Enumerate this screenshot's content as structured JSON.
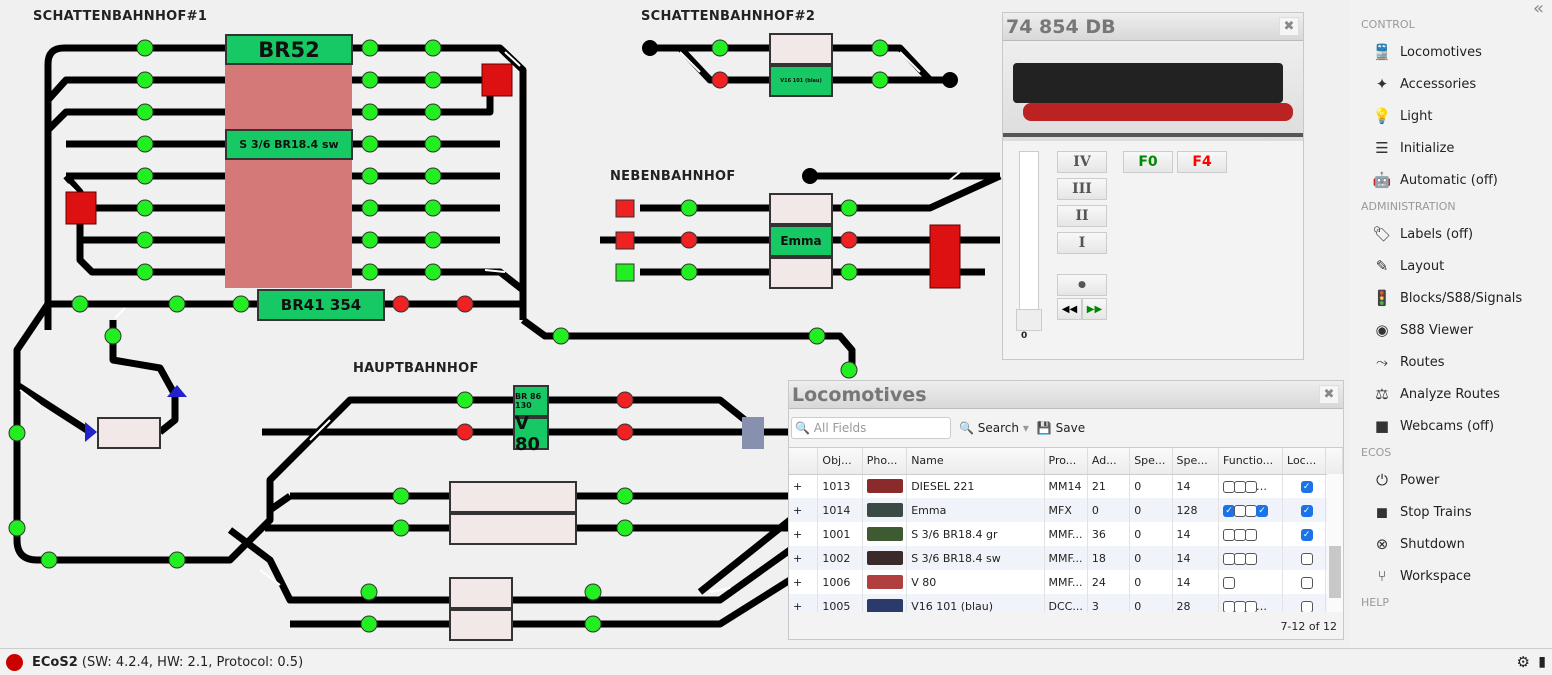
{
  "layout": {
    "titles": [
      "SCHATTENBAHNHOF#1",
      "SCHATTENBAHNHOF#2",
      "NEBENBAHNHOF",
      "HAUPTBAHNHOF"
    ],
    "blocks": {
      "br52": "BR52",
      "s36sw": "S 3/6 BR18.4 sw",
      "br41": "BR41 354",
      "v16": "V16 101 (blau)",
      "emma": "Emma",
      "br86": "BR 86 130",
      "v80": "V 80"
    }
  },
  "loco_panel": {
    "title": "74 854 DB",
    "speed_steps": [
      "IV",
      "III",
      "II",
      "I"
    ],
    "functions": [
      "F0",
      "F4"
    ],
    "speed_value": "0",
    "speed_fraction": 0,
    "close": "✖"
  },
  "locomotives": {
    "title": "Locomotives",
    "search_placeholder": "All Fields",
    "search_label": "Search",
    "save_label": "Save",
    "columns": [
      "",
      "Obj...",
      "Pho...",
      "Name",
      "Pro...",
      "Ad...",
      "Spe...",
      "Spe...",
      "Functio...",
      "Loc..."
    ],
    "rows": [
      {
        "obj": "1013",
        "photo": "#8b2a2a",
        "name": "DIESEL 221",
        "proto": "MM14",
        "addr": "21",
        "speed": "0",
        "steps": "14",
        "functions": [
          0,
          0,
          0
        ],
        "more": true,
        "loc": true
      },
      {
        "obj": "1014",
        "photo": "#3a4a44",
        "name": "Emma",
        "proto": "MFX",
        "addr": "0",
        "speed": "0",
        "steps": "128",
        "functions": [
          1,
          0,
          0,
          1
        ],
        "more": false,
        "loc": true
      },
      {
        "obj": "1001",
        "photo": "#3e5a32",
        "name": "S 3/6 BR18.4 gr",
        "proto": "MMF...",
        "addr": "36",
        "speed": "0",
        "steps": "14",
        "functions": [
          0,
          0,
          0
        ],
        "more": false,
        "loc": true
      },
      {
        "obj": "1002",
        "photo": "#3a2a2a",
        "name": "S 3/6 BR18.4 sw",
        "proto": "MMF...",
        "addr": "18",
        "speed": "0",
        "steps": "14",
        "functions": [
          0,
          0,
          0
        ],
        "more": false,
        "loc": false
      },
      {
        "obj": "1006",
        "photo": "#b04040",
        "name": "V 80",
        "proto": "MMF...",
        "addr": "24",
        "speed": "0",
        "steps": "14",
        "functions": [
          0
        ],
        "more": false,
        "loc": false
      },
      {
        "obj": "1005",
        "photo": "#2a3a6a",
        "name": "V16 101 (blau)",
        "proto": "DCC...",
        "addr": "3",
        "speed": "0",
        "steps": "28",
        "functions": [
          0,
          0,
          0
        ],
        "more": true,
        "loc": false
      }
    ],
    "pager": "7-12 of 12"
  },
  "sidebar": {
    "collapse": "«",
    "sections": [
      {
        "label": "CONTROL",
        "items": [
          {
            "icon": "locomotive-icon",
            "g": "🚆",
            "label": "Locomotives"
          },
          {
            "icon": "magic-wand-icon",
            "g": "✦",
            "label": "Accessories"
          },
          {
            "icon": "lightbulb-icon",
            "g": "💡",
            "label": "Light"
          },
          {
            "icon": "checklist-icon",
            "g": "☰",
            "label": "Initialize"
          },
          {
            "icon": "robot-icon",
            "g": "🤖",
            "label": "Automatic (off)"
          }
        ]
      },
      {
        "label": "ADMINISTRATION",
        "items": [
          {
            "icon": "tag-icon",
            "g": "🏷",
            "label": "Labels (off)"
          },
          {
            "icon": "edit-icon",
            "g": "✎",
            "label": "Layout"
          },
          {
            "icon": "traffic-light-icon",
            "g": "🚦",
            "label": "Blocks/S88/Signals"
          },
          {
            "icon": "viewer-icon",
            "g": "◉",
            "label": "S88 Viewer"
          },
          {
            "icon": "route-icon",
            "g": "⤳",
            "label": "Routes"
          },
          {
            "icon": "analyze-icon",
            "g": "⚖",
            "label": "Analyze Routes"
          },
          {
            "icon": "webcam-icon",
            "g": "■",
            "label": "Webcams (off)"
          }
        ]
      },
      {
        "label": "ECOS",
        "items": [
          {
            "icon": "power-icon",
            "g": "⏻",
            "label": "Power"
          },
          {
            "icon": "stop-icon",
            "g": "◼",
            "label": "Stop Trains"
          },
          {
            "icon": "shutdown-icon",
            "g": "⊗",
            "label": "Shutdown"
          },
          {
            "icon": "workspace-icon",
            "g": "⑂",
            "label": "Workspace"
          }
        ]
      },
      {
        "label": "HELP",
        "items": []
      }
    ]
  },
  "status": {
    "device": "ECoS2",
    "info": "(SW: 4.2.4, HW: 2.1, Protocol: 0.5)",
    "indicator_color": "#cc0000"
  },
  "colors": {
    "block_occupied": "#17c964",
    "block_free": "#f3e8e8",
    "signal_green": "#22ee22",
    "signal_red": "#ee2222"
  }
}
